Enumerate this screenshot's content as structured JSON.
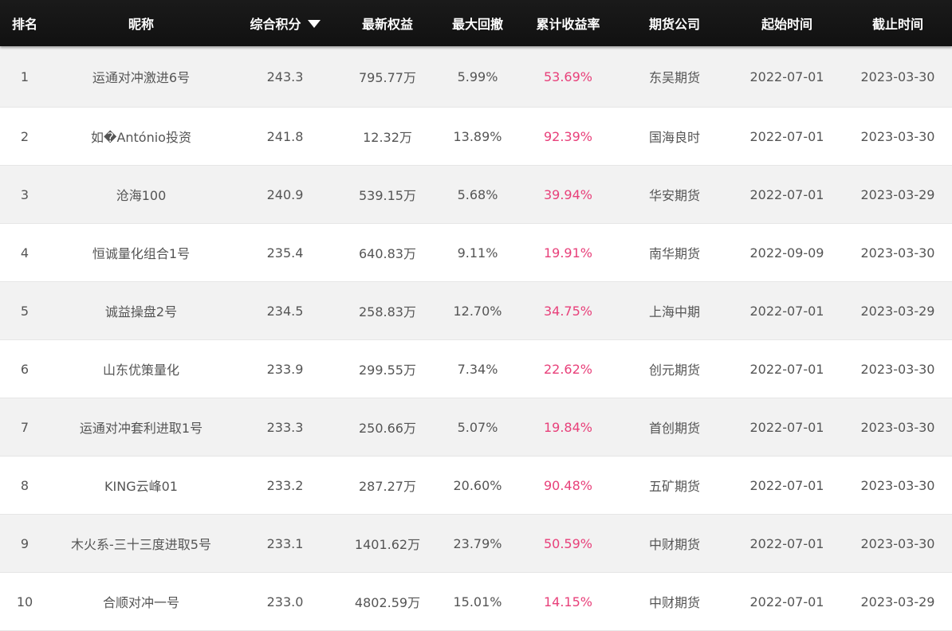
{
  "table": {
    "headers": {
      "rank": "排名",
      "nickname": "昵称",
      "score": "综合积分",
      "equity": "最新权益",
      "max_drawdown": "最大回撤",
      "cumulative_return": "累计收益率",
      "company": "期货公司",
      "start_date": "起始时间",
      "end_date": "截止时间"
    },
    "sort": {
      "column": "score",
      "direction": "descending",
      "icon": "sort-down-icon"
    },
    "accent_color": "#e8407a",
    "rows": [
      {
        "rank": "1",
        "nickname": "运通对冲激进6号",
        "score": "243.3",
        "equity": "795.77万",
        "max_drawdown": "5.99%",
        "cumulative_return": "53.69%",
        "company": "东吴期货",
        "start_date": "2022-07-01",
        "end_date": "2023-03-30"
      },
      {
        "rank": "2",
        "nickname": "如�António投资",
        "score": "241.8",
        "equity": "12.32万",
        "max_drawdown": "13.89%",
        "cumulative_return": "92.39%",
        "company": "国海良时",
        "start_date": "2022-07-01",
        "end_date": "2023-03-30"
      },
      {
        "rank": "3",
        "nickname": "沧海100",
        "score": "240.9",
        "equity": "539.15万",
        "max_drawdown": "5.68%",
        "cumulative_return": "39.94%",
        "company": "华安期货",
        "start_date": "2022-07-01",
        "end_date": "2023-03-29"
      },
      {
        "rank": "4",
        "nickname": "恒诚量化组合1号",
        "score": "235.4",
        "equity": "640.83万",
        "max_drawdown": "9.11%",
        "cumulative_return": "19.91%",
        "company": "南华期货",
        "start_date": "2022-09-09",
        "end_date": "2023-03-30"
      },
      {
        "rank": "5",
        "nickname": "诚益操盘2号",
        "score": "234.5",
        "equity": "258.83万",
        "max_drawdown": "12.70%",
        "cumulative_return": "34.75%",
        "company": "上海中期",
        "start_date": "2022-07-01",
        "end_date": "2023-03-29"
      },
      {
        "rank": "6",
        "nickname": "山东优策量化",
        "score": "233.9",
        "equity": "299.55万",
        "max_drawdown": "7.34%",
        "cumulative_return": "22.62%",
        "company": "创元期货",
        "start_date": "2022-07-01",
        "end_date": "2023-03-30"
      },
      {
        "rank": "7",
        "nickname": "运通对冲套利进取1号",
        "score": "233.3",
        "equity": "250.66万",
        "max_drawdown": "5.07%",
        "cumulative_return": "19.84%",
        "company": "首创期货",
        "start_date": "2022-07-01",
        "end_date": "2023-03-30"
      },
      {
        "rank": "8",
        "nickname": "KING云峰01",
        "score": "233.2",
        "equity": "287.27万",
        "max_drawdown": "20.60%",
        "cumulative_return": "90.48%",
        "company": "五矿期货",
        "start_date": "2022-07-01",
        "end_date": "2023-03-30"
      },
      {
        "rank": "9",
        "nickname": "木火系-三十三度进取5号",
        "score": "233.1",
        "equity": "1401.62万",
        "max_drawdown": "23.79%",
        "cumulative_return": "50.59%",
        "company": "中财期货",
        "start_date": "2022-07-01",
        "end_date": "2023-03-30"
      },
      {
        "rank": "10",
        "nickname": "合顺对冲一号",
        "score": "233.0",
        "equity": "4802.59万",
        "max_drawdown": "15.01%",
        "cumulative_return": "14.15%",
        "company": "中财期货",
        "start_date": "2022-07-01",
        "end_date": "2023-03-29"
      }
    ]
  }
}
